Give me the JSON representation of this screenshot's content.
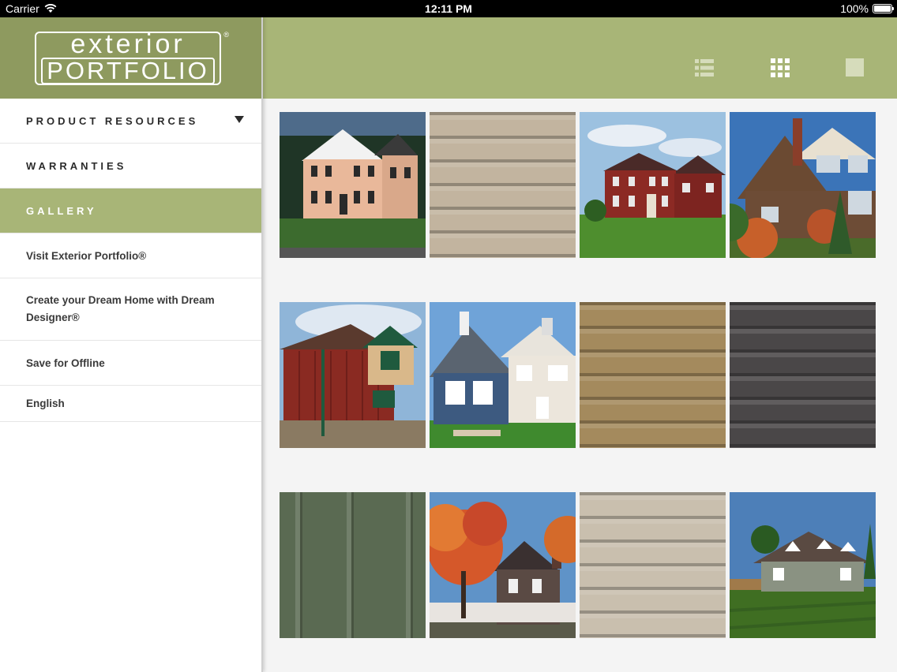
{
  "status_bar": {
    "carrier": "Carrier",
    "time": "12:11 PM",
    "battery": "100%"
  },
  "logo": {
    "line1": "exterior",
    "line2": "PORTFOLIO",
    "reg": "®"
  },
  "menu": {
    "product_resources": "PRODUCT RESOURCES",
    "warranties": "WARRANTIES",
    "gallery": "GALLERY",
    "visit": "Visit Exterior Portfolio®",
    "dream": "Create your Dream Home with Dream Designer®",
    "offline": "Save for Offline",
    "language": "English"
  },
  "toolbar": {
    "icons": [
      "list-view-icon",
      "grid-view-icon",
      "single-view-icon"
    ]
  },
  "colors": {
    "accent": "#a8b577",
    "logo_bg": "#8e9a5f"
  },
  "gallery": [
    {
      "kind": "house",
      "name": "colonial-peach-house"
    },
    {
      "kind": "siding",
      "name": "beige-siding",
      "color": "#c2b49f"
    },
    {
      "kind": "house",
      "name": "red-brick-house"
    },
    {
      "kind": "house",
      "name": "craftsman-house"
    },
    {
      "kind": "house",
      "name": "red-barn-house"
    },
    {
      "kind": "house",
      "name": "blue-house"
    },
    {
      "kind": "siding",
      "name": "tan-siding",
      "color": "#a48a5d"
    },
    {
      "kind": "siding",
      "name": "charcoal-siding",
      "color": "#4a4748"
    },
    {
      "kind": "board",
      "name": "green-board-batten",
      "color": "#5a6a52"
    },
    {
      "kind": "house",
      "name": "autumn-victorian-house"
    },
    {
      "kind": "siding",
      "name": "light-beige-siding",
      "color": "#c9bfae"
    },
    {
      "kind": "house",
      "name": "gray-cape-cod-house"
    }
  ]
}
